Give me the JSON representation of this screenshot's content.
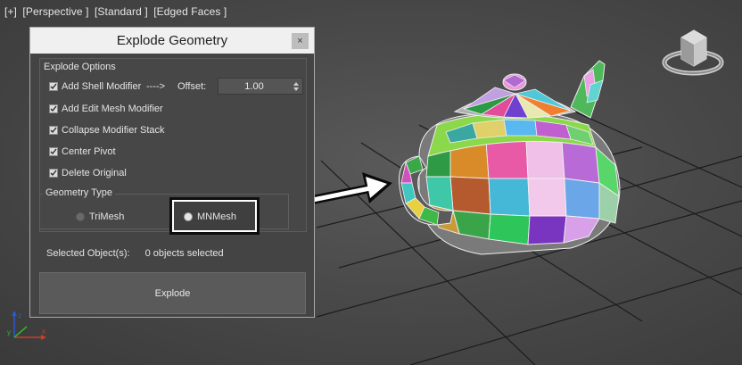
{
  "viewport": {
    "label_parts": [
      "[+]",
      "[Perspective ]",
      "[Standard ]",
      "[Edged Faces ]"
    ]
  },
  "dialog": {
    "title": "Explode Geometry",
    "close_label": "×",
    "explode_options": {
      "title": "Explode Options",
      "add_shell_modifier": {
        "label": "Add Shell Modifier",
        "checked": true
      },
      "arrow": "---->",
      "offset_label": "Offset:",
      "offset_value": "1.00",
      "add_edit_mesh": {
        "label": "Add Edit Mesh Modifier",
        "checked": true
      },
      "collapse_stack": {
        "label": "Collapse Modifier Stack",
        "checked": true
      },
      "center_pivot": {
        "label": "Center Pivot",
        "checked": true
      },
      "delete_original": {
        "label": "Delete Original",
        "checked": true
      }
    },
    "geometry_type": {
      "title": "Geometry Type",
      "trimesh_label": "TriMesh",
      "mnmesh_label": "MNMesh",
      "selected": "MNMesh"
    },
    "selected_objects_label": "Selected Object(s):",
    "selected_objects_value": "0 objects selected",
    "explode_button": "Explode"
  },
  "colors": {
    "dialog_bg": "#444444",
    "titlebar_bg": "#f0f0f0",
    "viewport_bg": "#4a4a4a",
    "grid": "#1a1a1a"
  },
  "icons": [
    "close-icon",
    "checkbox-checked-icon",
    "spinner-arrows-icon",
    "radio-icon",
    "view-cube-icon",
    "axis-gizmo-icon",
    "callout-arrow-icon"
  ]
}
